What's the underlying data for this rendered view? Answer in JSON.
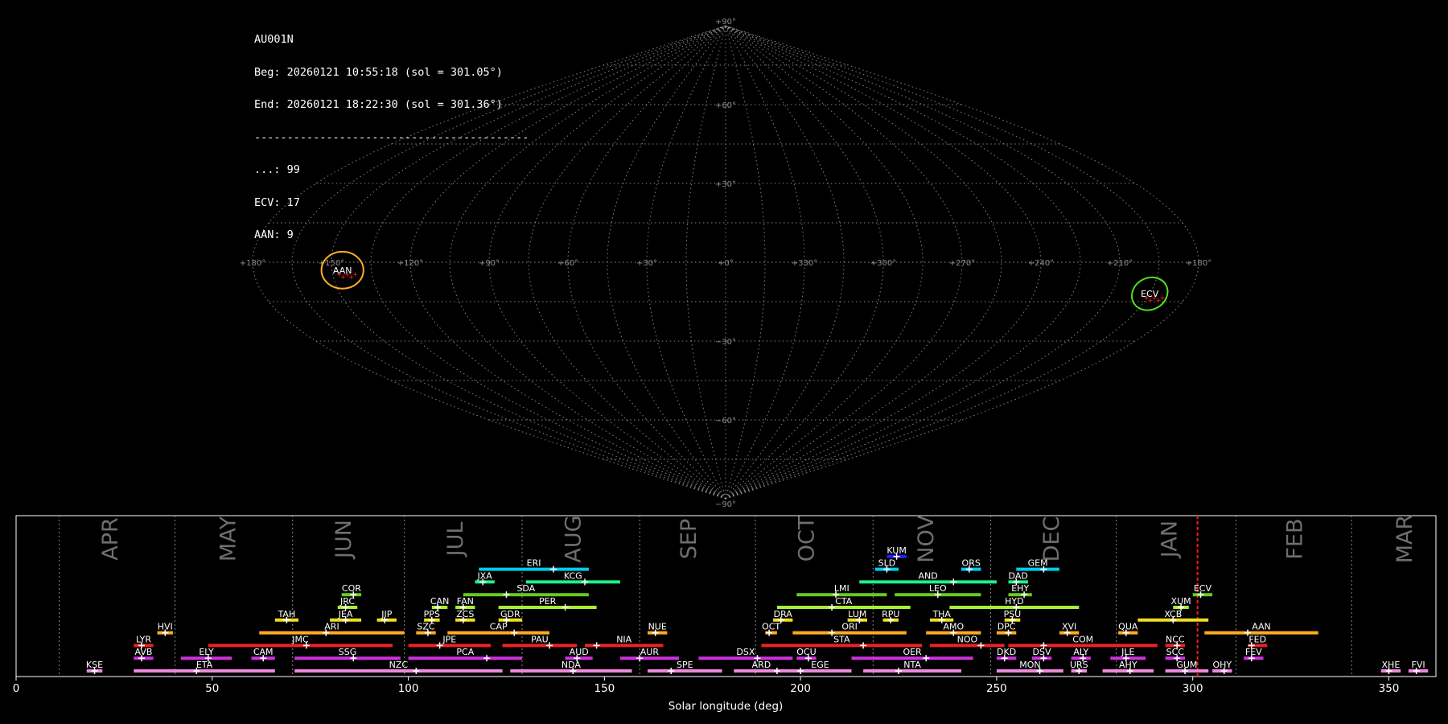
{
  "info": {
    "camera": "AU001N",
    "beg": "Beg: 20260121 10:55:18 (sol = 301.05°)",
    "end": "End: 20260121 18:22:30 (sol = 301.36°)",
    "sep": "------------------------------------------",
    "c1": "...: 99",
    "c2": "ECV: 17",
    "c3": "AAN: 9"
  },
  "colors": {
    "grid": "#9a9a9a",
    "aan": "#ffb020",
    "ecv": "#55dd22",
    "marker": "#ff2020"
  },
  "chart_data": [
    {
      "type": "scatter",
      "projection": "sinusoidal",
      "lon_labels": [
        "+180°",
        "+150°",
        "+120°",
        "+90°",
        "+60°",
        "+30°",
        "+0°",
        "+330°",
        "+300°",
        "+270°",
        "+240°",
        "+210°",
        "+180°"
      ],
      "lon_values": [
        180,
        150,
        120,
        90,
        60,
        30,
        0,
        330,
        300,
        270,
        240,
        210,
        180
      ],
      "lat_labels": [
        "+90°",
        "+60°",
        "+30°",
        "−30°",
        "−60°",
        "−90°"
      ],
      "lat_values": [
        90,
        60,
        30,
        -30,
        -60,
        -90
      ],
      "showers": [
        {
          "name": "AAN",
          "lon": 146,
          "lat": -3,
          "rlon": 8,
          "rlat": 7,
          "color": "#ffb020"
        },
        {
          "name": "ECV",
          "lon": 195,
          "lat": -12,
          "rlon": 7,
          "rlat": 6,
          "color": "#55dd22"
        }
      ]
    },
    {
      "type": "range",
      "xlabel": "Solar longitude (deg)",
      "xlim": [
        0,
        362
      ],
      "xticks": [
        0,
        50,
        100,
        150,
        200,
        250,
        300,
        350
      ],
      "month_boundaries": [
        11,
        40.5,
        70.5,
        99,
        129,
        159,
        188.5,
        218.5,
        248.5,
        280.5,
        311,
        340.5
      ],
      "months": [
        {
          "label": "APR",
          "x": 24
        },
        {
          "label": "MAY",
          "x": 54
        },
        {
          "label": "JUN",
          "x": 83.5
        },
        {
          "label": "JUL",
          "x": 112
        },
        {
          "label": "AUG",
          "x": 142
        },
        {
          "label": "SEP",
          "x": 171.5
        },
        {
          "label": "OCT",
          "x": 201.5
        },
        {
          "label": "NOV",
          "x": 232
        },
        {
          "label": "DEC",
          "x": 264
        },
        {
          "label": "JAN",
          "x": 294
        },
        {
          "label": "FEB",
          "x": 326
        },
        {
          "label": "MAR",
          "x": 354
        }
      ],
      "current_sol": 301.2,
      "showers": [
        {
          "name": "KUM",
          "s": 222,
          "e": 227,
          "p": 224.5,
          "row": 9,
          "color": "#2222ff"
        },
        {
          "name": "ERI",
          "s": 118,
          "e": 146,
          "p": 137,
          "row": 8,
          "color": "#00ccee"
        },
        {
          "name": "SLD",
          "s": 219,
          "e": 225,
          "p": 222,
          "row": 8,
          "color": "#00ccee"
        },
        {
          "name": "ORS",
          "s": 241,
          "e": 246,
          "p": 243,
          "row": 8,
          "color": "#00ccee"
        },
        {
          "name": "GEM",
          "s": 255,
          "e": 266,
          "p": 262,
          "row": 8,
          "color": "#00ccee"
        },
        {
          "name": "JXA",
          "s": 117,
          "e": 122,
          "p": 119,
          "row": 7,
          "color": "#22ee88"
        },
        {
          "name": "KCG",
          "s": 130,
          "e": 154,
          "p": 145,
          "row": 7,
          "color": "#22ee88"
        },
        {
          "name": "AND",
          "s": 215,
          "e": 250,
          "p": 239,
          "row": 7,
          "color": "#22ee88"
        },
        {
          "name": "DAD",
          "s": 253,
          "e": 258,
          "p": 255,
          "row": 7,
          "color": "#22ee88"
        },
        {
          "name": "COR",
          "s": 83,
          "e": 88,
          "p": 86,
          "row": 6,
          "color": "#66cc22"
        },
        {
          "name": "SDA",
          "s": 114,
          "e": 146,
          "p": 125,
          "row": 6,
          "color": "#66cc22"
        },
        {
          "name": "LMI",
          "s": 199,
          "e": 222,
          "p": 209,
          "row": 6,
          "color": "#66cc22"
        },
        {
          "name": "LEO",
          "s": 224,
          "e": 246,
          "p": 235,
          "row": 6,
          "color": "#66cc22"
        },
        {
          "name": "EHY",
          "s": 253,
          "e": 259,
          "p": 257,
          "row": 6,
          "color": "#66cc22"
        },
        {
          "name": "ECV",
          "s": 300,
          "e": 305,
          "p": 302,
          "row": 6,
          "color": "#66cc22"
        },
        {
          "name": "JRC",
          "s": 82,
          "e": 87,
          "p": 84,
          "row": 5,
          "color": "#aaee33"
        },
        {
          "name": "CAN",
          "s": 106,
          "e": 110,
          "p": 107.5,
          "row": 5,
          "color": "#aaee33"
        },
        {
          "name": "FAN",
          "s": 112,
          "e": 117,
          "p": 114,
          "row": 5,
          "color": "#aaee33"
        },
        {
          "name": "PER",
          "s": 123,
          "e": 148,
          "p": 140,
          "row": 5,
          "color": "#aaee33"
        },
        {
          "name": "CTA",
          "s": 194,
          "e": 228,
          "p": 208,
          "row": 5,
          "color": "#aaee33"
        },
        {
          "name": "HYD",
          "s": 238,
          "e": 271,
          "p": 255,
          "row": 5,
          "color": "#aaee33"
        },
        {
          "name": "XUM",
          "s": 295,
          "e": 299,
          "p": 297,
          "row": 5,
          "color": "#aaee33"
        },
        {
          "name": "TAH",
          "s": 66,
          "e": 72,
          "p": 69,
          "row": 4,
          "color": "#eedd22"
        },
        {
          "name": "JEA",
          "s": 80,
          "e": 88,
          "p": 84,
          "row": 4,
          "color": "#eedd22"
        },
        {
          "name": "JIP",
          "s": 92,
          "e": 97,
          "p": 94,
          "row": 4,
          "color": "#eedd22"
        },
        {
          "name": "PPS",
          "s": 104,
          "e": 108,
          "p": 106,
          "row": 4,
          "color": "#eedd22"
        },
        {
          "name": "ZCS",
          "s": 112,
          "e": 117,
          "p": 114,
          "row": 4,
          "color": "#eedd22"
        },
        {
          "name": "GDR",
          "s": 123,
          "e": 129,
          "p": 125,
          "row": 4,
          "color": "#eedd22"
        },
        {
          "name": "DRA",
          "s": 193,
          "e": 198,
          "p": 195,
          "row": 4,
          "color": "#eedd22"
        },
        {
          "name": "LUM",
          "s": 212,
          "e": 217,
          "p": 215,
          "row": 4,
          "color": "#eedd22"
        },
        {
          "name": "RPU",
          "s": 221,
          "e": 225,
          "p": 223,
          "row": 4,
          "color": "#eedd22"
        },
        {
          "name": "THA",
          "s": 233,
          "e": 239,
          "p": 236,
          "row": 4,
          "color": "#eedd22"
        },
        {
          "name": "PSU",
          "s": 252,
          "e": 256,
          "p": 254,
          "row": 4,
          "color": "#eedd22"
        },
        {
          "name": "XCB",
          "s": 286,
          "e": 304,
          "p": 295,
          "row": 4,
          "color": "#eedd22"
        },
        {
          "name": "HVI",
          "s": 36,
          "e": 40,
          "p": 38,
          "row": 3,
          "color": "#ffaa22"
        },
        {
          "name": "ARI",
          "s": 62,
          "e": 99,
          "p": 79,
          "row": 3,
          "color": "#ffaa22"
        },
        {
          "name": "SZC",
          "s": 102,
          "e": 107,
          "p": 105,
          "row": 3,
          "color": "#ffaa22"
        },
        {
          "name": "CAP",
          "s": 110,
          "e": 136,
          "p": 127,
          "row": 3,
          "color": "#ffaa22"
        },
        {
          "name": "NUE",
          "s": 161,
          "e": 166,
          "p": 163,
          "row": 3,
          "color": "#ffaa22"
        },
        {
          "name": "OCT",
          "s": 191,
          "e": 194,
          "p": 192,
          "row": 3,
          "color": "#ffaa22"
        },
        {
          "name": "ORI",
          "s": 198,
          "e": 227,
          "p": 208,
          "row": 3,
          "color": "#ffaa22"
        },
        {
          "name": "AMO",
          "s": 232,
          "e": 246,
          "p": 239,
          "row": 3,
          "color": "#ffaa22"
        },
        {
          "name": "DPC",
          "s": 250,
          "e": 255,
          "p": 253,
          "row": 3,
          "color": "#ffaa22"
        },
        {
          "name": "XVI",
          "s": 266,
          "e": 271,
          "p": 268,
          "row": 3,
          "color": "#ffaa22"
        },
        {
          "name": "QUA",
          "s": 281,
          "e": 286,
          "p": 283,
          "row": 3,
          "color": "#ffaa22"
        },
        {
          "name": "AAN",
          "s": 303,
          "e": 332,
          "p": 314,
          "row": 3,
          "color": "#ffaa22"
        },
        {
          "name": "LYR",
          "s": 30,
          "e": 35,
          "p": 32,
          "row": 2,
          "color": "#ee2222"
        },
        {
          "name": "JMC",
          "s": 49,
          "e": 96,
          "p": 74,
          "row": 2,
          "color": "#ee2222"
        },
        {
          "name": "JPE",
          "s": 100,
          "e": 121,
          "p": 108,
          "row": 2,
          "color": "#ee2222"
        },
        {
          "name": "PAU",
          "s": 124,
          "e": 143,
          "p": 136,
          "row": 2,
          "color": "#ee2222"
        },
        {
          "name": "NIA",
          "s": 145,
          "e": 165,
          "p": 148,
          "row": 2,
          "color": "#ee2222"
        },
        {
          "name": "STA",
          "s": 190,
          "e": 231,
          "p": 216,
          "row": 2,
          "color": "#ee2222"
        },
        {
          "name": "NOO",
          "s": 233,
          "e": 252,
          "p": 246,
          "row": 2,
          "color": "#ee2222"
        },
        {
          "name": "COM",
          "s": 253,
          "e": 291,
          "p": 262,
          "row": 2,
          "color": "#ee2222"
        },
        {
          "name": "NCC",
          "s": 293,
          "e": 298,
          "p": 296,
          "row": 2,
          "color": "#ee2222"
        },
        {
          "name": "FED",
          "s": 314,
          "e": 319,
          "p": 315,
          "row": 2,
          "color": "#ee2222"
        },
        {
          "name": "AVB",
          "s": 30,
          "e": 35,
          "p": 32,
          "row": 1,
          "color": "#cc33dd"
        },
        {
          "name": "ELY",
          "s": 42,
          "e": 55,
          "p": 49,
          "row": 1,
          "color": "#cc33dd"
        },
        {
          "name": "CAM",
          "s": 60,
          "e": 66,
          "p": 63,
          "row": 1,
          "color": "#cc33dd"
        },
        {
          "name": "SSG",
          "s": 71,
          "e": 98,
          "p": 86,
          "row": 1,
          "color": "#cc33dd"
        },
        {
          "name": "PCA",
          "s": 100,
          "e": 129,
          "p": 120,
          "row": 1,
          "color": "#cc33dd"
        },
        {
          "name": "AUD",
          "s": 140,
          "e": 147,
          "p": 143,
          "row": 1,
          "color": "#cc33dd"
        },
        {
          "name": "AUR",
          "s": 154,
          "e": 169,
          "p": 159,
          "row": 1,
          "color": "#cc33dd"
        },
        {
          "name": "DSX",
          "s": 174,
          "e": 198,
          "p": 189,
          "row": 1,
          "color": "#cc33dd"
        },
        {
          "name": "OCU",
          "s": 199,
          "e": 204,
          "p": 202,
          "row": 1,
          "color": "#cc33dd"
        },
        {
          "name": "OER",
          "s": 213,
          "e": 244,
          "p": 232,
          "row": 1,
          "color": "#cc33dd"
        },
        {
          "name": "DKD",
          "s": 250,
          "e": 255,
          "p": 252,
          "row": 1,
          "color": "#cc33dd"
        },
        {
          "name": "DSV",
          "s": 259,
          "e": 264,
          "p": 262,
          "row": 1,
          "color": "#cc33dd"
        },
        {
          "name": "ALY",
          "s": 269,
          "e": 274,
          "p": 272,
          "row": 1,
          "color": "#cc33dd"
        },
        {
          "name": "JLE",
          "s": 279,
          "e": 288,
          "p": 283,
          "row": 1,
          "color": "#cc33dd"
        },
        {
          "name": "SCC",
          "s": 293,
          "e": 298,
          "p": 296,
          "row": 1,
          "color": "#cc33dd"
        },
        {
          "name": "FEV",
          "s": 313,
          "e": 318,
          "p": 315,
          "row": 1,
          "color": "#cc33dd"
        },
        {
          "name": "KSE",
          "s": 18,
          "e": 22,
          "p": 20,
          "row": 0,
          "color": "#ee88dd"
        },
        {
          "name": "ETA",
          "s": 30,
          "e": 66,
          "p": 46,
          "row": 0,
          "color": "#ee88dd"
        },
        {
          "name": "NZC",
          "s": 71,
          "e": 124,
          "p": 102,
          "row": 0,
          "color": "#ee88dd"
        },
        {
          "name": "NDA",
          "s": 126,
          "e": 157,
          "p": 142,
          "row": 0,
          "color": "#ee88dd"
        },
        {
          "name": "SPE",
          "s": 161,
          "e": 180,
          "p": 167,
          "row": 0,
          "color": "#ee88dd"
        },
        {
          "name": "ARD",
          "s": 183,
          "e": 197,
          "p": 194,
          "row": 0,
          "color": "#ee88dd"
        },
        {
          "name": "EGE",
          "s": 197,
          "e": 213,
          "p": 200,
          "row": 0,
          "color": "#ee88dd"
        },
        {
          "name": "NTA",
          "s": 216,
          "e": 241,
          "p": 225,
          "row": 0,
          "color": "#ee88dd"
        },
        {
          "name": "MON",
          "s": 250,
          "e": 267,
          "p": 261,
          "row": 0,
          "color": "#ee88dd"
        },
        {
          "name": "URS",
          "s": 269,
          "e": 273,
          "p": 271,
          "row": 0,
          "color": "#ee88dd"
        },
        {
          "name": "AHY",
          "s": 277,
          "e": 290,
          "p": 284,
          "row": 0,
          "color": "#ee88dd"
        },
        {
          "name": "GUM",
          "s": 293,
          "e": 304,
          "p": 298,
          "row": 0,
          "color": "#ee88dd"
        },
        {
          "name": "OHY",
          "s": 305,
          "e": 310,
          "p": 308,
          "row": 0,
          "color": "#ee88dd"
        },
        {
          "name": "XHE",
          "s": 348,
          "e": 353,
          "p": 350,
          "row": 0,
          "color": "#ee88dd"
        },
        {
          "name": "FVI",
          "s": 355,
          "e": 360,
          "p": 357,
          "row": 0,
          "color": "#ee88dd"
        }
      ]
    }
  ]
}
